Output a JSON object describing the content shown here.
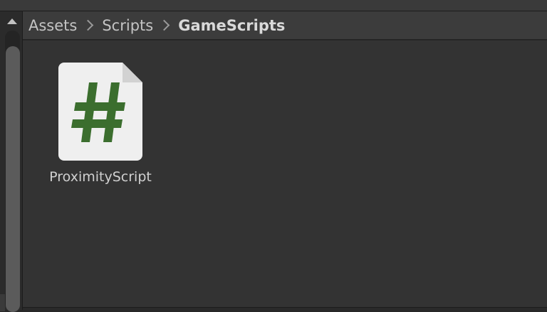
{
  "breadcrumb": {
    "items": [
      "Assets",
      "Scripts",
      "GameScripts"
    ]
  },
  "assets": [
    {
      "name": "ProximityScript",
      "icon": "csharp-script-icon",
      "icon_color": "#3b6e2e"
    }
  ],
  "colors": {
    "panel_bg": "#333333",
    "breadcrumb_bg": "#3c3c3c",
    "script_icon_bg": "#efefef",
    "script_hash": "#3b6e2e"
  }
}
